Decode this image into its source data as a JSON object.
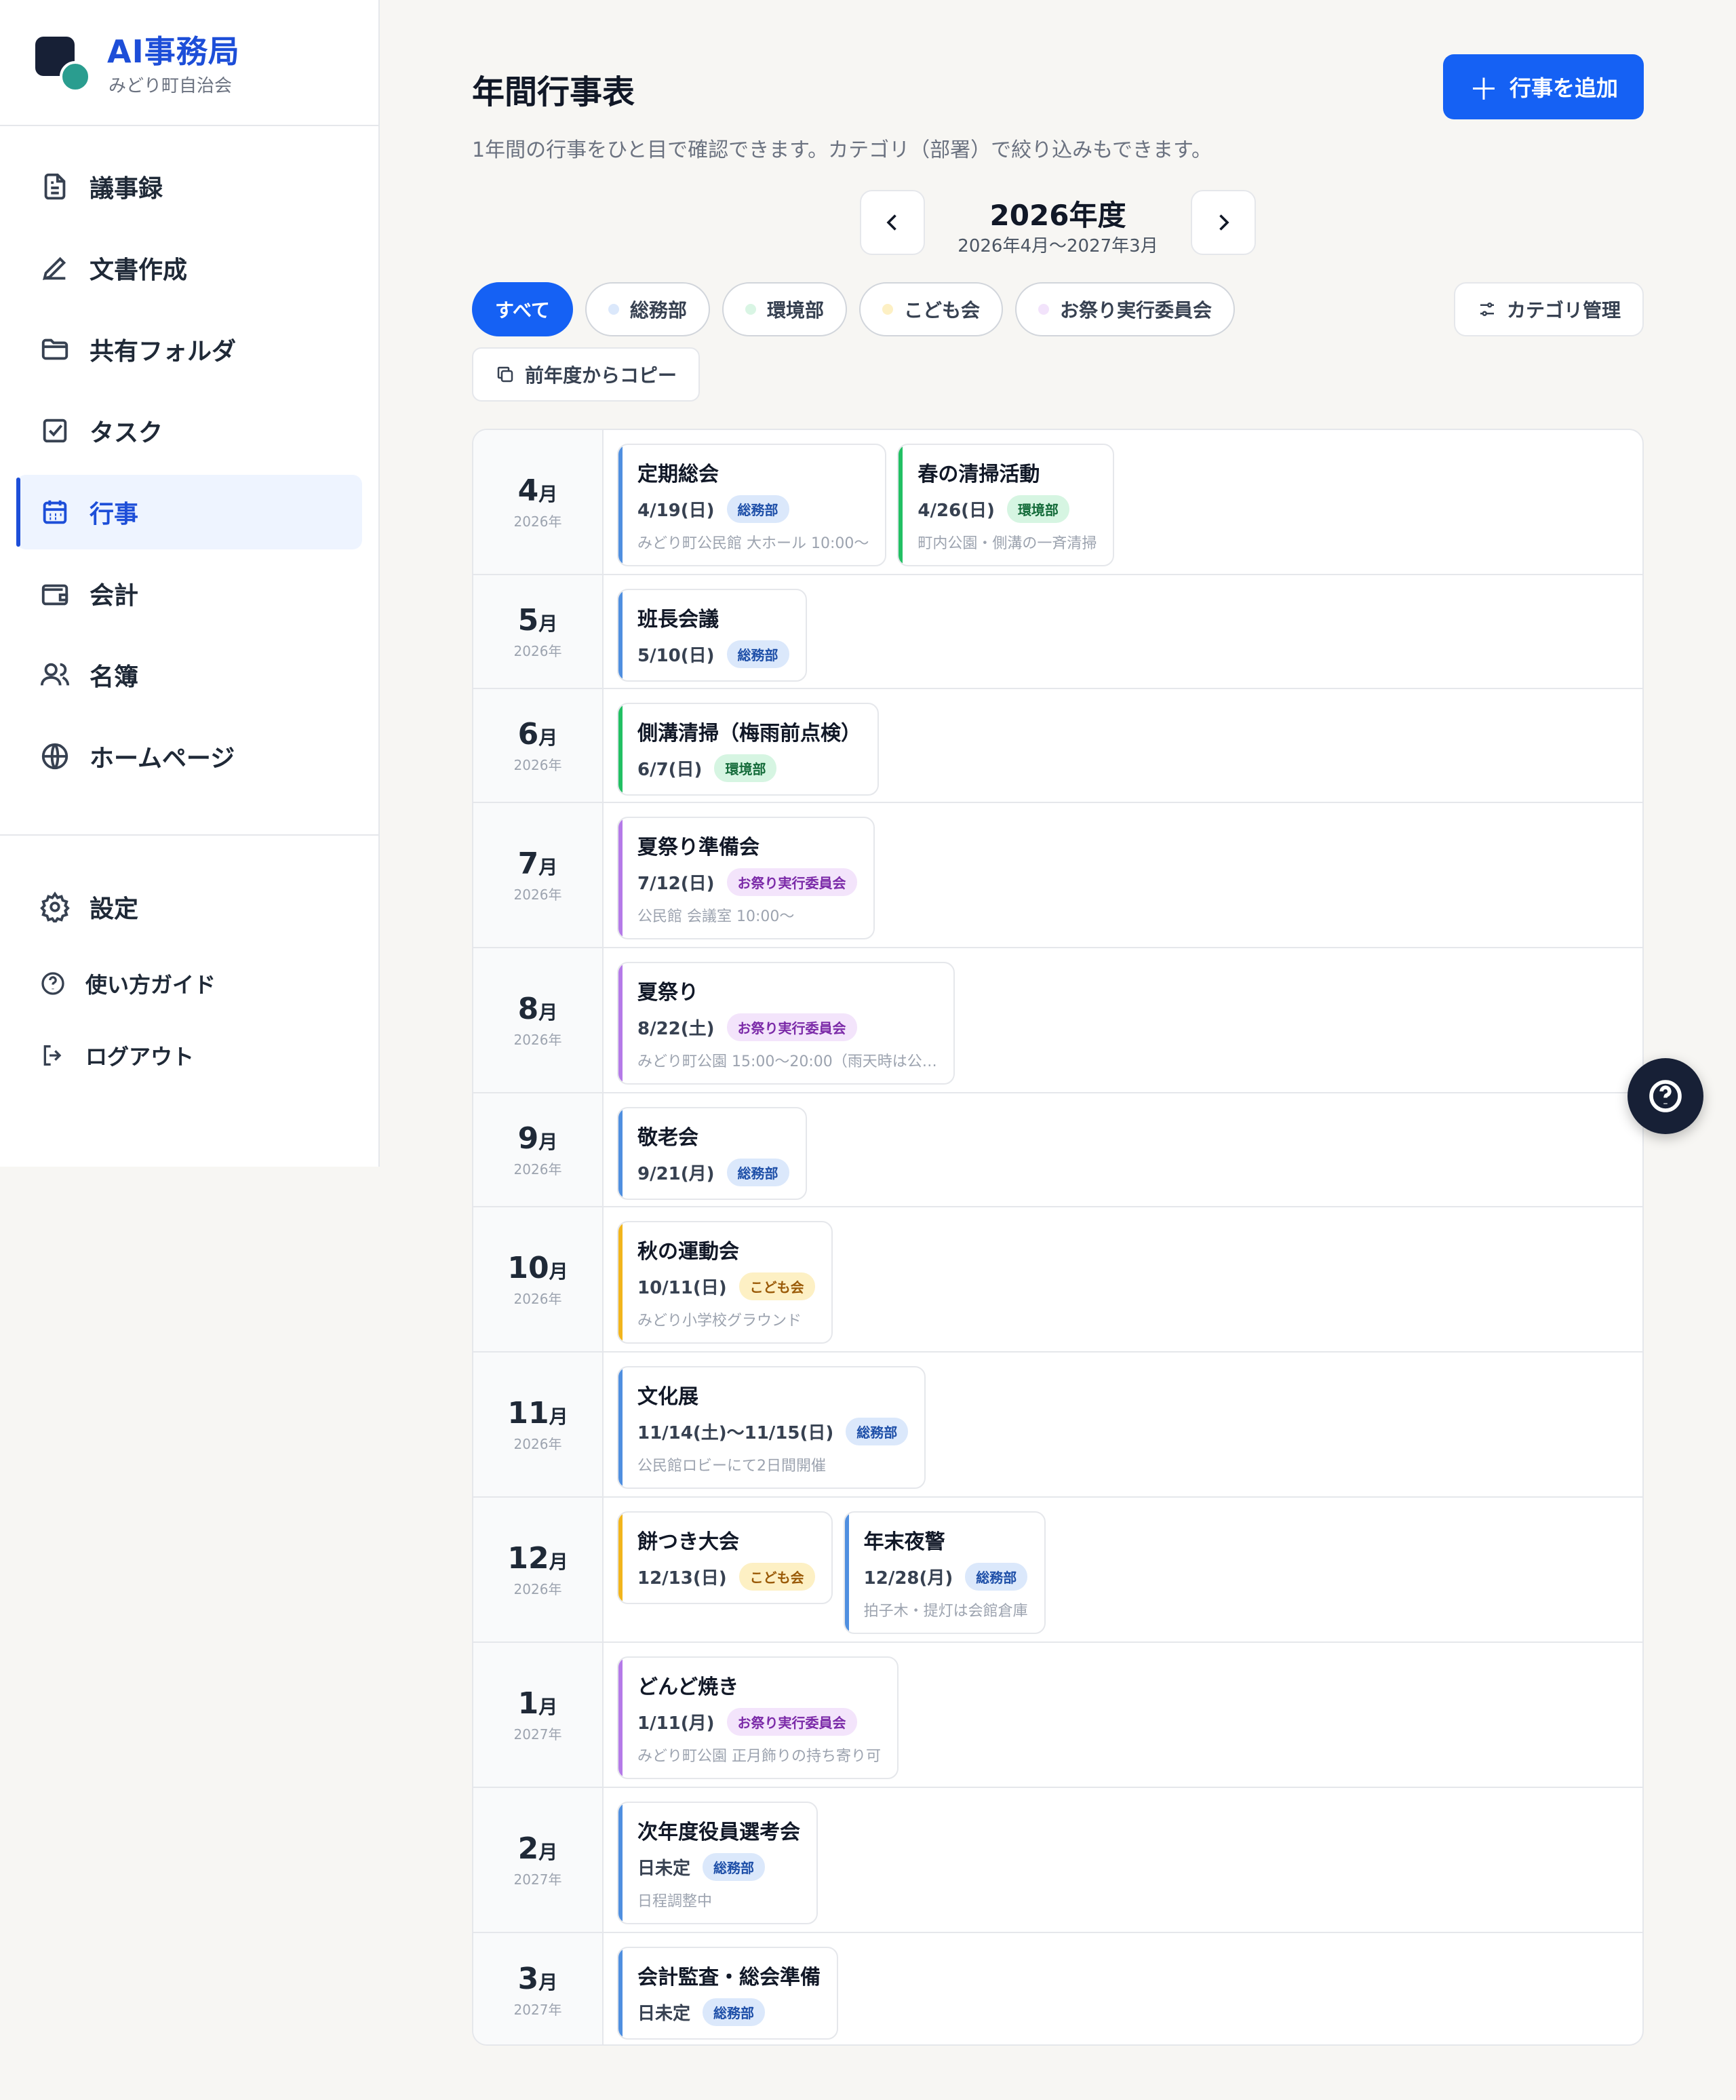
{
  "brand": {
    "title": "AI事務局",
    "subtitle": "みどり町自治会"
  },
  "nav": [
    {
      "label": "議事録",
      "icon": "document-icon"
    },
    {
      "label": "文書作成",
      "icon": "pen-icon"
    },
    {
      "label": "共有フォルダ",
      "icon": "folder-icon"
    },
    {
      "label": "タスク",
      "icon": "checkbox-icon"
    },
    {
      "label": "行事",
      "icon": "calendar-icon",
      "active": true
    },
    {
      "label": "会計",
      "icon": "wallet-icon"
    },
    {
      "label": "名簿",
      "icon": "users-icon"
    },
    {
      "label": "ホームページ",
      "icon": "globe-icon"
    }
  ],
  "nav_bottom": {
    "settings": "設定",
    "guide": "使い方ガイド",
    "logout": "ログアウト"
  },
  "header": {
    "title": "年間行事表",
    "description": "1年間の行事をひと目で確認できます。カテゴリ（部署）で絞り込みもできます。",
    "add_button": "行事を追加"
  },
  "year_nav": {
    "label": "2026年度",
    "range": "2026年4月〜2027年3月"
  },
  "filters": {
    "all": "すべて",
    "categories": [
      {
        "label": "総務部",
        "color": "#dbe8fb"
      },
      {
        "label": "環境部",
        "color": "#d9f5e4"
      },
      {
        "label": "こども会",
        "color": "#fdf0c4"
      },
      {
        "label": "お祭り実行委員会",
        "color": "#f2e3fb"
      }
    ],
    "category_manage": "カテゴリ管理",
    "copy_prev": "前年度からコピー"
  },
  "colors": {
    "総務部": {
      "bar": "#4f8fe0",
      "bg": "#dbe8fb",
      "fg": "#1e4fa8"
    },
    "環境部": {
      "bar": "#22c063",
      "bg": "#d6f5e2",
      "fg": "#146b3a"
    },
    "こども会": {
      "bar": "#f2b51c",
      "bg": "#fdf0c4",
      "fg": "#9a5a07"
    },
    "お祭り実行委員会": {
      "bar": "#b57ae8",
      "bg": "#f3e4fb",
      "fg": "#7b2aa8"
    }
  },
  "months": [
    {
      "month": "4",
      "unit": "月",
      "year": "2026年",
      "events": [
        {
          "title": "定期総会",
          "date": "4/19(日)",
          "category": "総務部",
          "note": "みどり町公民館 大ホール 10:00〜"
        },
        {
          "title": "春の清掃活動",
          "date": "4/26(日)",
          "category": "環境部",
          "note": "町内公園・側溝の一斉清掃"
        }
      ]
    },
    {
      "month": "5",
      "unit": "月",
      "year": "2026年",
      "events": [
        {
          "title": "班長会議",
          "date": "5/10(日)",
          "category": "総務部",
          "note": ""
        }
      ]
    },
    {
      "month": "6",
      "unit": "月",
      "year": "2026年",
      "events": [
        {
          "title": "側溝清掃（梅雨前点検）",
          "date": "6/7(日)",
          "category": "環境部",
          "note": ""
        }
      ]
    },
    {
      "month": "7",
      "unit": "月",
      "year": "2026年",
      "events": [
        {
          "title": "夏祭り準備会",
          "date": "7/12(日)",
          "category": "お祭り実行委員会",
          "note": "公民館 会議室 10:00〜"
        }
      ]
    },
    {
      "month": "8",
      "unit": "月",
      "year": "2026年",
      "events": [
        {
          "title": "夏祭り",
          "date": "8/22(土)",
          "category": "お祭り実行委員会",
          "note": "みどり町公園 15:00〜20:00（雨天時は公…"
        }
      ]
    },
    {
      "month": "9",
      "unit": "月",
      "year": "2026年",
      "events": [
        {
          "title": "敬老会",
          "date": "9/21(月)",
          "category": "総務部",
          "note": ""
        }
      ]
    },
    {
      "month": "10",
      "unit": "月",
      "year": "2026年",
      "events": [
        {
          "title": "秋の運動会",
          "date": "10/11(日)",
          "category": "こども会",
          "note": "みどり小学校グラウンド"
        }
      ]
    },
    {
      "month": "11",
      "unit": "月",
      "year": "2026年",
      "events": [
        {
          "title": "文化展",
          "date": "11/14(土)〜11/15(日)",
          "category": "総務部",
          "note": "公民館ロビーにて2日間開催"
        }
      ]
    },
    {
      "month": "12",
      "unit": "月",
      "year": "2026年",
      "events": [
        {
          "title": "餅つき大会",
          "date": "12/13(日)",
          "category": "こども会",
          "note": ""
        },
        {
          "title": "年末夜警",
          "date": "12/28(月)",
          "category": "総務部",
          "note": "拍子木・提灯は会館倉庫"
        }
      ]
    },
    {
      "month": "1",
      "unit": "月",
      "year": "2027年",
      "events": [
        {
          "title": "どんど焼き",
          "date": "1/11(月)",
          "category": "お祭り実行委員会",
          "note": "みどり町公園 正月飾りの持ち寄り可"
        }
      ]
    },
    {
      "month": "2",
      "unit": "月",
      "year": "2027年",
      "events": [
        {
          "title": "次年度役員選考会",
          "date": "日未定",
          "category": "総務部",
          "note": "日程調整中"
        }
      ]
    },
    {
      "month": "3",
      "unit": "月",
      "year": "2027年",
      "events": [
        {
          "title": "会計監査・総会準備",
          "date": "日未定",
          "category": "総務部",
          "note": ""
        }
      ]
    }
  ]
}
